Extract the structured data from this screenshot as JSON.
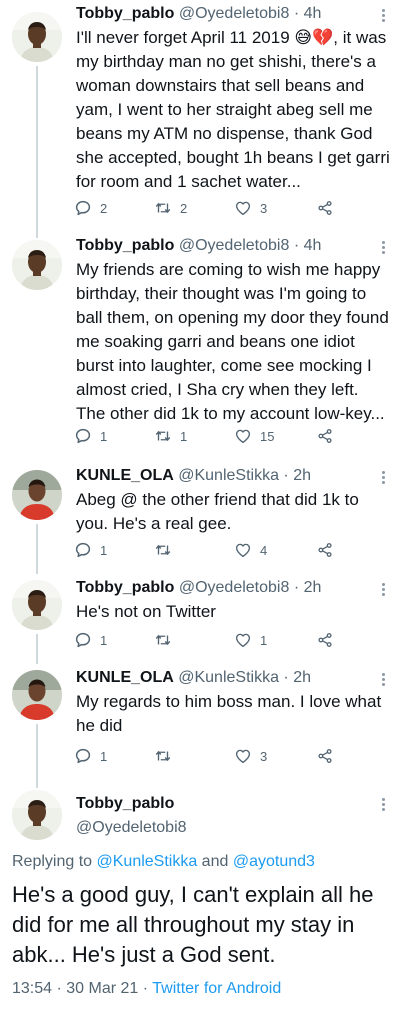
{
  "colors": {
    "accent": "#1d9bf0",
    "secondary_text": "#536471",
    "text": "#0f1419"
  },
  "tweets": [
    {
      "name": "Tobby_pablo",
      "handle": "@Oyedeletobi8",
      "time": "4h",
      "text_a": "I'll never forget April 11 2019 ",
      "emoji": "😅💔",
      "text_b": ", it was my birthday man no get shishi, there's a woman downstairs that sell beans and yam, I went to her straight abeg sell me beans my ATM no dispense, thank God she accepted, bought 1h beans I get garri for room and 1 sachet water...",
      "replies": "2",
      "retweets": "2",
      "likes": "3"
    },
    {
      "name": "Tobby_pablo",
      "handle": "@Oyedeletobi8",
      "time": "4h",
      "text": "My friends are coming to wish me happy birthday, their thought was I'm going to ball them, on opening my door they found me soaking garri and beans one idiot burst into laughter, come see mocking I almost cried, I Sha cry when they left. The other did 1k to my account low-key...",
      "replies": "1",
      "retweets": "1",
      "likes": "15"
    },
    {
      "name": "KUNLE_OLA",
      "handle": "@KunleStikka",
      "time": "2h",
      "text": "Abeg @ the other friend that did 1k to you. He's a real gee.",
      "replies": "1",
      "retweets": "",
      "likes": "4"
    },
    {
      "name": "Tobby_pablo",
      "handle": "@Oyedeletobi8",
      "time": "2h",
      "text": "He's not on Twitter",
      "replies": "1",
      "retweets": "",
      "likes": "1"
    },
    {
      "name": "KUNLE_OLA",
      "handle": "@KunleStikka",
      "time": "2h",
      "text": "My regards to him boss man. I love what he did",
      "replies": "1",
      "retweets": "",
      "likes": "3"
    }
  ],
  "separator": "·",
  "main_tweet": {
    "name": "Tobby_pablo",
    "handle": "@Oyedeletobi8",
    "replying_prefix": "Replying to ",
    "reply_user_1": "@KunleStikka",
    "reply_and": " and ",
    "reply_user_2": "@ayotund3",
    "text": "He's a good guy, I can't explain all he did for me all throughout my stay in abk... He's just a God sent.",
    "time": "13:54",
    "date": "30 Mar 21",
    "source": "Twitter for Android"
  },
  "icons": {
    "reply": "reply-icon",
    "retweet": "retweet-icon",
    "like": "heart-icon",
    "share": "share-icon",
    "more": "more-icon"
  }
}
